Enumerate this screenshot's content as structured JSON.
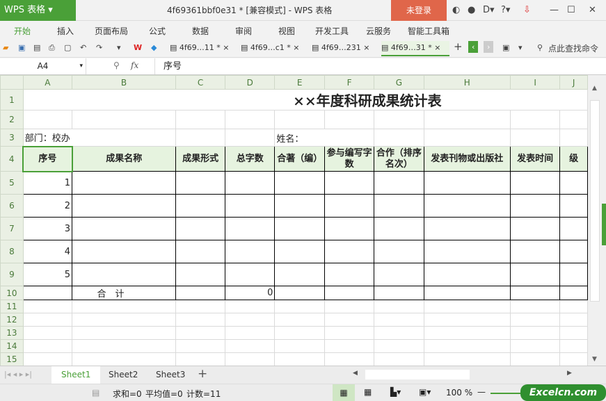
{
  "app": {
    "name": "WPS 表格",
    "doc_title": "4f69361bbf0e31 * [兼容模式] - WPS 表格",
    "login": "未登录"
  },
  "menu": [
    "开始",
    "插入",
    "页面布局",
    "公式",
    "数据",
    "审阅",
    "视图",
    "开发工具",
    "云服务",
    "智能工具箱"
  ],
  "doc_tabs": [
    "4f69…11 *",
    "4f69…c1 *",
    "4f69…231",
    "4f69…31 *"
  ],
  "search_cmd": "点此查找命令",
  "formula": {
    "name_box": "A4",
    "fx": "fx",
    "value": "序号"
  },
  "columns": [
    "A",
    "B",
    "C",
    "D",
    "E",
    "F",
    "G",
    "H",
    "I",
    "J"
  ],
  "rows": [
    "1",
    "2",
    "3",
    "4",
    "5",
    "6",
    "7",
    "8",
    "9",
    "10",
    "11",
    "12",
    "13",
    "14",
    "15"
  ],
  "sheet": {
    "title": "××年度科研成果统计表",
    "dept": "部门：校办",
    "name_label": "姓名：",
    "headers": [
      "序号",
      "成果名称",
      "成果形式",
      "总字数",
      "合著（编）",
      "参与编写字数",
      "合作（排序名次）",
      "发表刊物或出版社",
      "发表时间",
      "级"
    ],
    "serials": [
      "1",
      "2",
      "3",
      "4",
      "5"
    ],
    "total_label": "合　计",
    "total_value": "0"
  },
  "sheets": [
    "Sheet1",
    "Sheet2",
    "Sheet3"
  ],
  "status": {
    "sum": "求和=0",
    "avg": "平均值=0",
    "count": "计数=11",
    "zoom": "100 %"
  },
  "watermark": "Excelcn.com"
}
